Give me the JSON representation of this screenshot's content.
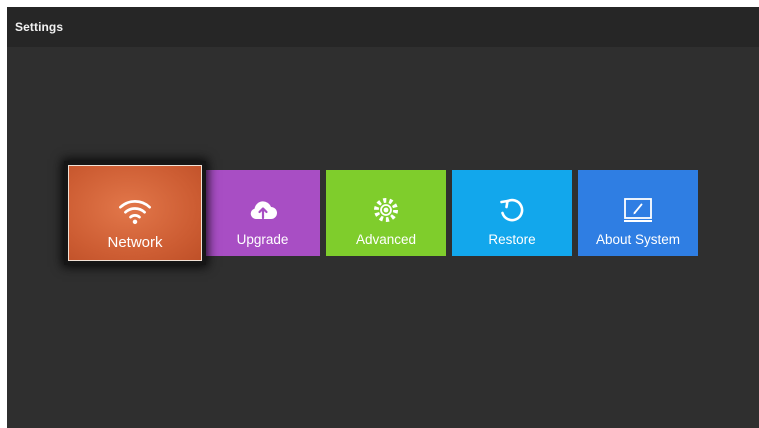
{
  "window": {
    "title": "Settings"
  },
  "tiles": [
    {
      "label": "Network",
      "icon": "wifi-icon",
      "color": "#cd5d33",
      "focused": true
    },
    {
      "label": "Upgrade",
      "icon": "cloud-upload-icon",
      "color": "#a84ec4",
      "focused": false
    },
    {
      "label": "Advanced",
      "icon": "gear-icon",
      "color": "#7fcd2c",
      "focused": false
    },
    {
      "label": "Restore",
      "icon": "refresh-icon",
      "color": "#12a7ec",
      "focused": false
    },
    {
      "label": "About System",
      "icon": "monitor-icon",
      "color": "#2f7ee3",
      "focused": false
    }
  ],
  "colors": {
    "background": "#2f2f2f",
    "titlebar": "#262626"
  }
}
